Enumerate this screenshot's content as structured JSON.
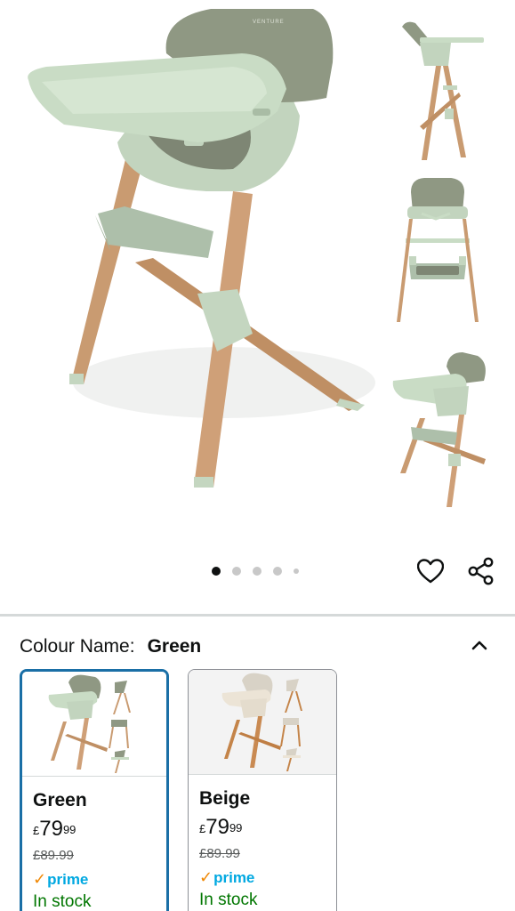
{
  "product": {
    "brand_mark": "VENTURE"
  },
  "gallery": {
    "dots": [
      true,
      false,
      false,
      false,
      false
    ],
    "icons": [
      "heart-icon",
      "share-icon"
    ]
  },
  "colour": {
    "label": "Colour Name:",
    "value": "Green",
    "chevron_icon": "chevron-up-icon"
  },
  "variants": [
    {
      "name": "Green",
      "currency": "£",
      "price_whole": "79",
      "price_fraction": "99",
      "was_price": "£89.99",
      "prime": "prime",
      "stock": "In stock",
      "selected": true
    },
    {
      "name": "Beige",
      "currency": "£",
      "price_whole": "79",
      "price_fraction": "99",
      "was_price": "£89.99",
      "prime": "prime",
      "stock": "In stock",
      "selected": false
    }
  ],
  "colors": {
    "selected_border": "#1a6fa6",
    "in_stock": "#007600",
    "prime_blue": "#00a8e1",
    "prime_tick": "#f08804",
    "chair_green": "#b9cbb5",
    "seat_olive": "#8f9883",
    "wood": "#c99b71"
  }
}
